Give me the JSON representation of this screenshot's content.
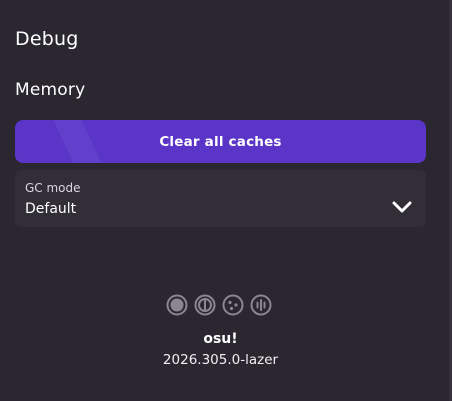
{
  "settings": {
    "section_title": "Debug",
    "subsection_title": "Memory",
    "clear_caches_label": "Clear all caches",
    "gc_mode": {
      "caption": "GC mode",
      "selected": "Default"
    }
  },
  "footer": {
    "icons": [
      "osu-standard-icon",
      "osu-taiko-icon",
      "osu-catch-icon",
      "osu-mania-icon"
    ],
    "app_name": "osu!",
    "version": "2026.305.0-lazer"
  },
  "colors": {
    "background": "#2a2731",
    "accent": "#5a35c8",
    "dropdown_bg": "#312e38",
    "icon_gray": "#8a8790"
  }
}
